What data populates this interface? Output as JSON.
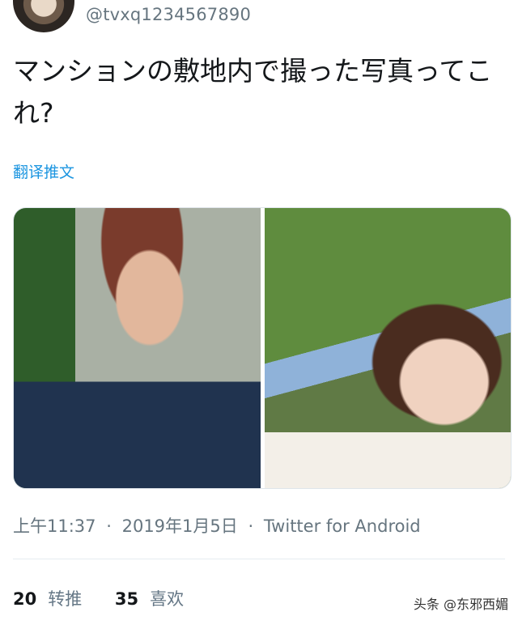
{
  "tweet": {
    "handle": "@tvxq1234567890",
    "text": "マンションの敷地内で撮った写真ってこれ?",
    "translate_label": "翻译推文",
    "time": "上午11:37",
    "date": "2019年1月5日",
    "source": "Twitter for Android",
    "separator": "·"
  },
  "stats": {
    "retweets_count": "20",
    "retweets_label": "转推",
    "likes_count": "35",
    "likes_label": "喜欢"
  },
  "watermark": "头条 @东邪西媚"
}
